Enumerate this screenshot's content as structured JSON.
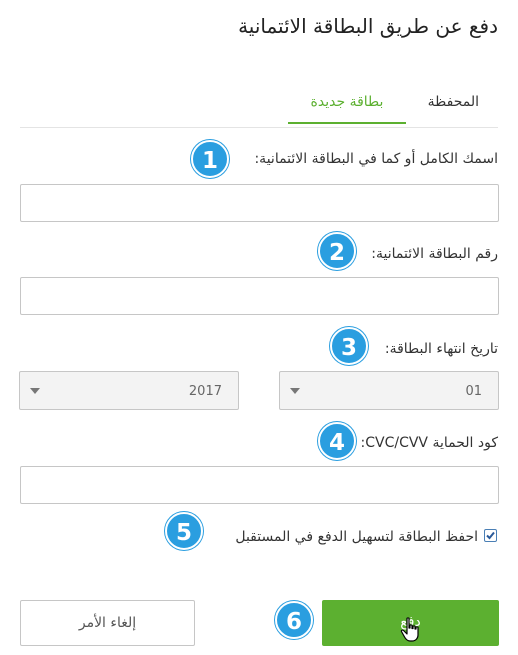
{
  "page": {
    "title": "دفع عن طريق البطاقة الائتمانية"
  },
  "tabs": {
    "wallet": "المحفظة",
    "new_card": "بطاقة جديدة",
    "active": "new_card"
  },
  "form": {
    "name_label": "اسمك الكامل أو كما في البطاقة الائتمانية:",
    "name_value": "",
    "card_number_label": "رقم البطاقة الائتمانية:",
    "card_number_value": "",
    "expiry_label": "تاريخ انتهاء البطاقة:",
    "expiry_month": "01",
    "expiry_year": "2017",
    "cvc_label": "كود الحماية CVC/CVV:",
    "cvc_value": "",
    "save_card_label": "احفظ البطاقة لتسهيل الدفع في المستقبل",
    "save_card_checked": true
  },
  "buttons": {
    "pay": "دفع",
    "cancel": "إلغاء الأمر"
  },
  "callouts": [
    "1",
    "2",
    "3",
    "4",
    "5",
    "6"
  ],
  "colors": {
    "accent_green": "#5cb030",
    "callout_blue": "#2a9ee0"
  }
}
